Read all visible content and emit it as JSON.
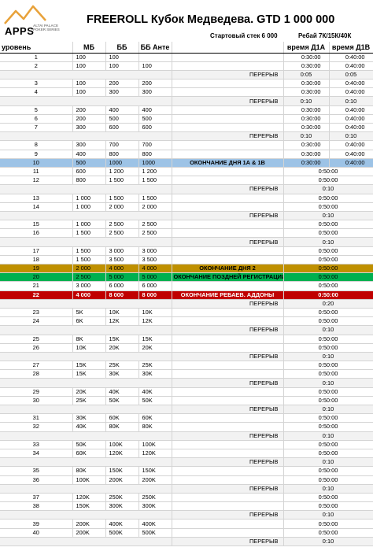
{
  "logo": {
    "text": "APPS",
    "sub1": "ALTAI PALACE",
    "sub2": "POKER SERIES"
  },
  "title": "FREEROLL Кубок Медведева. GTD  1 000 000",
  "start_stack": "Стартовый стек 6 000",
  "rebuy": "Ребай 7К/15К/40К",
  "headers": {
    "level": "уровень",
    "mb": "МБ",
    "bb": "ББ",
    "ante": "ББ Анте",
    "d1a": "время Д1А",
    "d1b": "время Д1В"
  },
  "break_label": "ПЕРЕРЫВ",
  "levels": [
    {
      "type": "lvl",
      "l": "1",
      "mb": "100",
      "bb": "100",
      "ante": "",
      "a": "0:30:00",
      "b": "0:40:00"
    },
    {
      "type": "lvl",
      "l": "2",
      "mb": "100",
      "bb": "100",
      "ante": "100",
      "a": "0:30:00",
      "b": "0:40:00"
    },
    {
      "type": "brk",
      "a": "0:05",
      "b": "0:05"
    },
    {
      "type": "lvl",
      "l": "3",
      "mb": "100",
      "bb": "200",
      "ante": "200",
      "a": "0:30:00",
      "b": "0:40:00"
    },
    {
      "type": "lvl",
      "l": "4",
      "mb": "100",
      "bb": "300",
      "ante": "300",
      "a": "0:30:00",
      "b": "0:40:00"
    },
    {
      "type": "brk",
      "a": "0:10",
      "b": "0:10"
    },
    {
      "type": "lvl",
      "l": "5",
      "mb": "200",
      "bb": "400",
      "ante": "400",
      "a": "0:30:00",
      "b": "0:40:00"
    },
    {
      "type": "lvl",
      "l": "6",
      "mb": "200",
      "bb": "500",
      "ante": "500",
      "a": "0:30:00",
      "b": "0:40:00"
    },
    {
      "type": "lvl",
      "l": "7",
      "mb": "300",
      "bb": "600",
      "ante": "600",
      "a": "0:30:00",
      "b": "0:40:00"
    },
    {
      "type": "brk",
      "a": "0:10",
      "b": "0:10"
    },
    {
      "type": "lvl",
      "l": "8",
      "mb": "300",
      "bb": "700",
      "ante": "700",
      "a": "0:30:00",
      "b": "0:40:00"
    },
    {
      "type": "lvl",
      "l": "9",
      "mb": "400",
      "bb": "800",
      "ante": "800",
      "a": "0:30:00",
      "b": "0:40:00"
    },
    {
      "type": "evt",
      "style": "blue",
      "l": "10",
      "mb": "500",
      "bb": "1000",
      "ante": "1000",
      "label": "ОКОНЧАНИЕ ДНЯ 1А & 1В",
      "a": "0:30:00",
      "b": "0:40:00"
    },
    {
      "type": "lvl",
      "l": "11",
      "mb": "600",
      "bb": "1 200",
      "ante": "1 200",
      "t": "0:50:00"
    },
    {
      "type": "lvl",
      "l": "12",
      "mb": "800",
      "bb": "1 500",
      "ante": "1 500",
      "t": "0:50:00"
    },
    {
      "type": "brk1",
      "t": "0:10"
    },
    {
      "type": "lvl",
      "l": "13",
      "mb": "1 000",
      "bb": "1 500",
      "ante": "1 500",
      "t": "0:50:00"
    },
    {
      "type": "lvl",
      "l": "14",
      "mb": "1 000",
      "bb": "2 000",
      "ante": "2 000",
      "t": "0:50:00"
    },
    {
      "type": "brk1",
      "t": "0:10"
    },
    {
      "type": "lvl",
      "l": "15",
      "mb": "1 000",
      "bb": "2 500",
      "ante": "2 500",
      "t": "0:50:00"
    },
    {
      "type": "lvl",
      "l": "16",
      "mb": "1 500",
      "bb": "2 500",
      "ante": "2 500",
      "t": "0:50:00"
    },
    {
      "type": "brk1",
      "t": "0:10"
    },
    {
      "type": "lvl",
      "l": "17",
      "mb": "1 500",
      "bb": "3 000",
      "ante": "3 000",
      "t": "0:50:00"
    },
    {
      "type": "lvl",
      "l": "18",
      "mb": "1 500",
      "bb": "3 500",
      "ante": "3 500",
      "t": "0:50:00"
    },
    {
      "type": "evt",
      "style": "gold",
      "l": "19",
      "mb": "2 000",
      "bb": "4 000",
      "ante": "4 000",
      "label": "ОКОНЧАНИЕ ДНЯ 2",
      "t": "0:50:00"
    },
    {
      "type": "evt",
      "style": "green",
      "l": "20",
      "mb": "2 500",
      "bb": "5 000",
      "ante": "5 000",
      "label": "ОКОНЧАНИЕ ПОЗДНЕЙ РЕГИСТРАЦИИ",
      "t": "0:50:00"
    },
    {
      "type": "lvl",
      "l": "21",
      "mb": "3 000",
      "bb": "6 000",
      "ante": "6 000",
      "t": "0:50:00"
    },
    {
      "type": "evt",
      "style": "red",
      "l": "22",
      "mb": "4 000",
      "bb": "8 000",
      "ante": "8 000",
      "label": "ОКОНЧАНИЕ РЕБАЕВ. АДДОНЫ",
      "t": "0:50:00"
    },
    {
      "type": "brk1",
      "t": "0:20"
    },
    {
      "type": "lvl",
      "l": "23",
      "mb": "5K",
      "bb": "10K",
      "ante": "10K",
      "t": "0:50:00"
    },
    {
      "type": "lvl",
      "l": "24",
      "mb": "6K",
      "bb": "12K",
      "ante": "12K",
      "t": "0:50:00"
    },
    {
      "type": "brk1",
      "t": "0:10"
    },
    {
      "type": "lvl",
      "l": "25",
      "mb": "8K",
      "bb": "15K",
      "ante": "15K",
      "t": "0:50:00"
    },
    {
      "type": "lvl",
      "l": "26",
      "mb": "10K",
      "bb": "20K",
      "ante": "20K",
      "t": "0:50:00"
    },
    {
      "type": "brk1",
      "t": "0:10"
    },
    {
      "type": "lvl",
      "l": "27",
      "mb": "15K",
      "bb": "25K",
      "ante": "25K",
      "t": "0:50:00"
    },
    {
      "type": "lvl",
      "l": "28",
      "mb": "15K",
      "bb": "30K",
      "ante": "30K",
      "t": "0:50:00"
    },
    {
      "type": "brk1",
      "t": "0:10"
    },
    {
      "type": "lvl",
      "l": "29",
      "mb": "20K",
      "bb": "40K",
      "ante": "40K",
      "t": "0:50:00"
    },
    {
      "type": "lvl",
      "l": "30",
      "mb": "25K",
      "bb": "50K",
      "ante": "50K",
      "t": "0:50:00"
    },
    {
      "type": "brk1",
      "t": "0:10"
    },
    {
      "type": "lvl",
      "l": "31",
      "mb": "30K",
      "bb": "60K",
      "ante": "60K",
      "t": "0:50:00"
    },
    {
      "type": "lvl",
      "l": "32",
      "mb": "40K",
      "bb": "80K",
      "ante": "80K",
      "t": "0:50:00"
    },
    {
      "type": "brk1",
      "t": "0:10"
    },
    {
      "type": "lvl",
      "l": "33",
      "mb": "50K",
      "bb": "100K",
      "ante": "100K",
      "t": "0:50:00"
    },
    {
      "type": "lvl",
      "l": "34",
      "mb": "60K",
      "bb": "120K",
      "ante": "120K",
      "t": "0:50:00"
    },
    {
      "type": "brk1",
      "t": "0:10"
    },
    {
      "type": "lvl",
      "l": "35",
      "mb": "80K",
      "bb": "150K",
      "ante": "150K",
      "t": "0:50:00"
    },
    {
      "type": "lvl",
      "l": "36",
      "mb": "100K",
      "bb": "200K",
      "ante": "200K",
      "t": "0:50:00"
    },
    {
      "type": "brk1",
      "t": "0:10"
    },
    {
      "type": "lvl",
      "l": "37",
      "mb": "120K",
      "bb": "250K",
      "ante": "250K",
      "t": "0:50:00"
    },
    {
      "type": "lvl",
      "l": "38",
      "mb": "150K",
      "bb": "300K",
      "ante": "300K",
      "t": "0:50:00"
    },
    {
      "type": "brk1",
      "t": "0:10"
    },
    {
      "type": "lvl",
      "l": "39",
      "mb": "200K",
      "bb": "400K",
      "ante": "400K",
      "t": "0:50:00"
    },
    {
      "type": "lvl",
      "l": "40",
      "mb": "200K",
      "bb": "500K",
      "ante": "500K",
      "t": "0:50:00"
    },
    {
      "type": "brk1",
      "t": "0:10"
    }
  ],
  "colors": {
    "blue": "#9dc3e6",
    "gold": "#bf9000",
    "green": "#00b050",
    "red": "#c00000",
    "logo_orange": "#e8a23a"
  }
}
